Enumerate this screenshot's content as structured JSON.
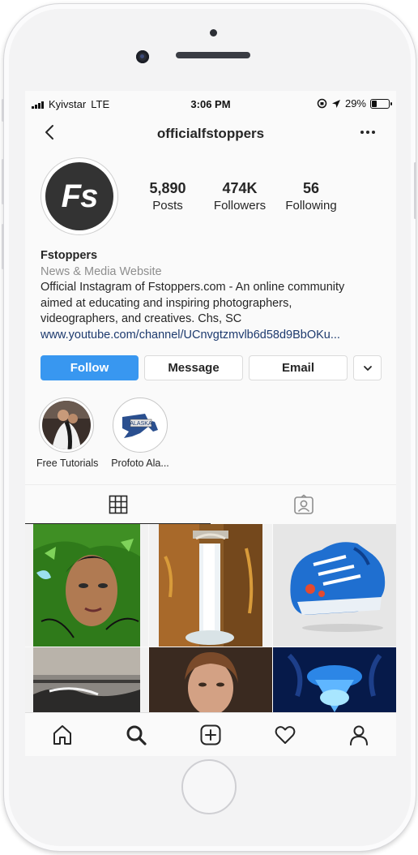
{
  "status": {
    "carrier": "Kyivstar",
    "network": "LTE",
    "time": "3:06 PM",
    "battery": "29%"
  },
  "nav": {
    "username": "officialfstoppers",
    "back_icon": "chevron-left-icon",
    "more_icon": "ellipsis-icon"
  },
  "profile": {
    "avatar_text": "Fs",
    "stats": [
      {
        "value": "5,890",
        "label": "Posts"
      },
      {
        "value": "474K",
        "label": "Followers"
      },
      {
        "value": "56",
        "label": "Following"
      }
    ],
    "name": "Fstoppers",
    "category": "News & Media Website",
    "bio_lines": [
      "Official Instagram of Fstoppers.com - An online community",
      "aimed at educating and inspiring photographers,",
      "videographers, and creatives. Chs, SC"
    ],
    "link": "www.youtube.com/channel/UCnvgtzmvlb6d58d9BbOKu..."
  },
  "actions": {
    "follow": "Follow",
    "message": "Message",
    "email": "Email"
  },
  "highlights": [
    {
      "label": "Free Tutorials"
    },
    {
      "label": "Profoto Ala...",
      "badge": "ALASKA"
    }
  ],
  "tabs": [
    {
      "icon": "grid-icon"
    },
    {
      "icon": "tagged-icon"
    }
  ],
  "bottom_nav": [
    "home-icon",
    "search-icon",
    "add-icon",
    "heart-icon",
    "profile-icon"
  ],
  "colors": {
    "follow_blue": "#3897f0",
    "link_blue": "#1d3a6e",
    "category_gray": "#8e8e8e"
  }
}
